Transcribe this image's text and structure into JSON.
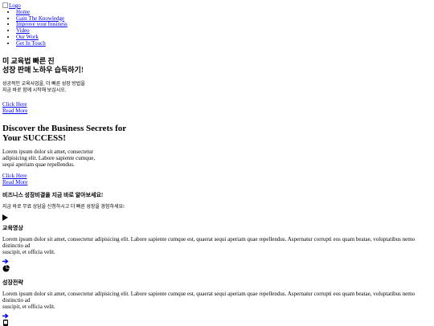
{
  "logo": {
    "alt": "Logo"
  },
  "nav": {
    "items": [
      "Home",
      "Gain The Knowledge",
      "Improve your business",
      "Video",
      "Our Work",
      "Get In Touch"
    ]
  },
  "hero_ko": {
    "line1": "미 교육법 빠른 진",
    "line2": "성장 판매 노하우 습득하기!",
    "sub_line1": "성공적인 교육사업을, 더 빠른 성장 방법을",
    "sub_line2": "지금 바로 함께 시작해 보십시오."
  },
  "links1": {
    "click": "Click Here",
    "read": "Read More"
  },
  "hero_en": {
    "line1": "Discover the Business Secrets for",
    "line2": "Your SUCCESS!"
  },
  "intro": {
    "line1": "Lorem ipsum dolor sit amet, consectetur",
    "line2": "adipisicing elit. Labore sapiente cumque,",
    "line3": "sequi aperiam quae repellendus."
  },
  "links2": {
    "click": "Click Here",
    "read": "Read More"
  },
  "cta": {
    "title": "비즈니스 성장비결을 지금 바로 알아보세요!",
    "sub": "지금 바로 무료 상담을 신청하시고 더 빠른 성장을 경험하세요!"
  },
  "features": [
    {
      "icon": "play-icon",
      "title": "교육영상",
      "text1": "Lorem ipsum dolor sit amet, consectetur adipisicing elit. Labore sapiente cumque est, quaerat sequi aperiam quae repellendus. Aspernatur corrupti eos quam beatae, voluptatibus nemo distinctio ad",
      "text2": "suscipit, et officia velit."
    },
    {
      "icon": "pie-chart-icon",
      "title": "성장전략",
      "text1": "Lorem ipsum dolor sit amet, consectetur adipisicing elit. Labore sapiente cumque est, quaerat sequi aperiam quae repellendus. Aspernatur corrupti eos quam beatae, voluptatibus nemo distinctio ad",
      "text2": "suscipit, et officia velit."
    }
  ]
}
